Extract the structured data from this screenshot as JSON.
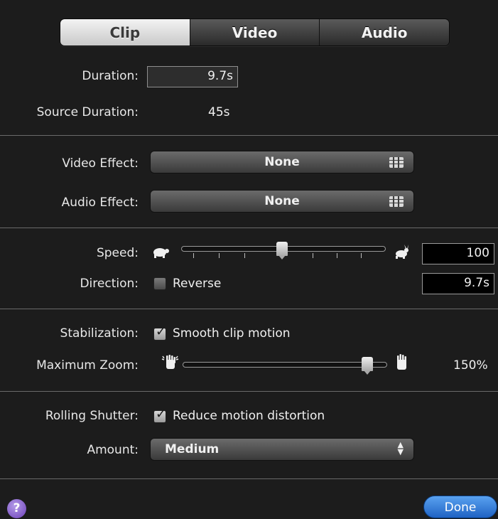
{
  "tabs": [
    {
      "label": "Clip",
      "active": true
    },
    {
      "label": "Video",
      "active": false
    },
    {
      "label": "Audio",
      "active": false
    }
  ],
  "clip": {
    "duration_label": "Duration:",
    "duration_value": "9.7s",
    "source_duration_label": "Source Duration:",
    "source_duration_value": "45s"
  },
  "effects": {
    "video_effect_label": "Video Effect:",
    "video_effect_value": "None",
    "audio_effect_label": "Audio Effect:",
    "audio_effect_value": "None"
  },
  "speed": {
    "speed_label": "Speed:",
    "speed_value": "100",
    "speed_level": 0.5,
    "direction_label": "Direction:",
    "reverse_label": "Reverse",
    "reverse_checked": false,
    "duration_value": "9.7s"
  },
  "stabilization": {
    "label": "Stabilization:",
    "checkbox_label": "Smooth clip motion",
    "checked": true,
    "max_zoom_label": "Maximum Zoom:",
    "max_zoom_value": "150%",
    "max_zoom_level": 0.95
  },
  "rolling_shutter": {
    "label": "Rolling Shutter:",
    "checkbox_label": "Reduce motion distortion",
    "checked": true,
    "amount_label": "Amount:",
    "amount_value": "Medium"
  },
  "footer": {
    "help_label": "?",
    "done_label": "Done"
  },
  "colors": {
    "background": "#1c1c1c",
    "done_button": "#2f7ae0",
    "help_button": "#7b52c9"
  }
}
